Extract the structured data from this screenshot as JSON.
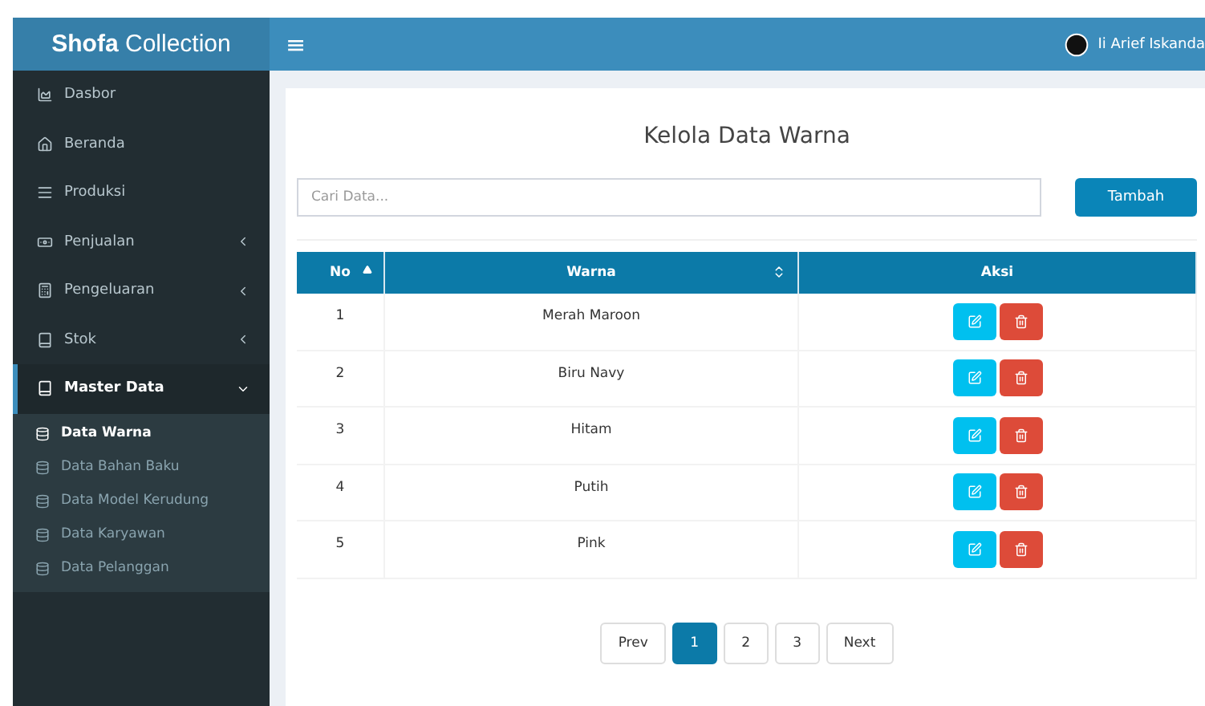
{
  "sidebar": {
    "brand": "**Shofa** Collection",
    "items": [
      {
        "label": "Dasbor",
        "kind": "link",
        "selected": false
      },
      {
        "label": "Beranda",
        "kind": "link",
        "selected": false
      },
      {
        "label": "Produksi",
        "kind": "link",
        "selected": false
      },
      {
        "label": "Penjualan",
        "kind": "menu",
        "expanded": false,
        "selected": false
      },
      {
        "label": "Pengeluaran",
        "kind": "menu",
        "expanded": false,
        "selected": false
      },
      {
        "label": "Stok",
        "kind": "menu",
        "expanded": false,
        "selected": false
      },
      {
        "label": "Master Data",
        "kind": "menu",
        "selected": true,
        "expanded": true,
        "children": [
          {
            "label": "Data Warna",
            "selected": true
          },
          {
            "label": "Data Bahan Baku",
            "selected": false
          },
          {
            "label": "Data Model Kerudung",
            "selected": false
          },
          {
            "label": "Data Karyawan",
            "selected": false
          },
          {
            "label": "Data Pelanggan",
            "selected": false
          }
        ]
      }
    ]
  },
  "topbar": {
    "menu_glyph": "≡",
    "user": "Ii Arief Iskanda"
  },
  "title": "Kelola Data Warna",
  "search": {
    "placeholder": "Cari Data..."
  },
  "add_button": "Tambah",
  "table": {
    "columns": [
      {
        "label": "No",
        "kind": "sorted"
      },
      {
        "label": "Warna",
        "kind": "sortable"
      },
      {
        "label": "Aksi",
        "kind": "plain"
      }
    ],
    "rows": [
      {
        "no": "1",
        "warna": "Merah Maroon"
      },
      {
        "no": "2",
        "warna": "Biru Navy"
      },
      {
        "no": "3",
        "warna": "Hitam"
      },
      {
        "no": "4",
        "warna": "Putih"
      },
      {
        "no": "5",
        "warna": "Pink"
      }
    ]
  },
  "pagination": [
    {
      "label": "Prev",
      "selected": false
    },
    {
      "label": "1",
      "selected": true
    },
    {
      "label": "2",
      "selected": false
    },
    {
      "label": "3",
      "selected": false
    },
    {
      "label": "Next",
      "selected": false
    }
  ]
}
